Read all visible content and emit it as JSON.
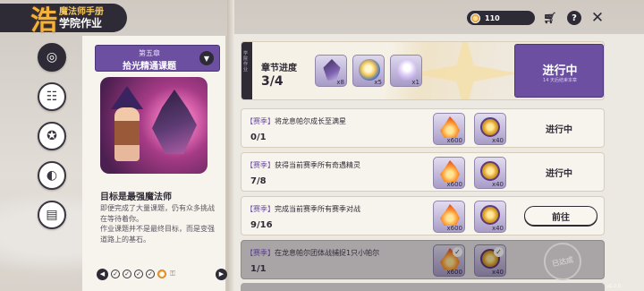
{
  "logo": {
    "mark": "浩",
    "line1": "魔法师手册",
    "line2": "学院作业"
  },
  "sidebar": {
    "items": [
      {
        "name": "sidebar-item-tasks",
        "icon": "◎",
        "active": true
      },
      {
        "name": "sidebar-item-book",
        "icon": "☷",
        "active": false
      },
      {
        "name": "sidebar-item-medal",
        "icon": "✪",
        "active": false
      },
      {
        "name": "sidebar-item-pet",
        "icon": "◐",
        "active": false
      },
      {
        "name": "sidebar-item-cards",
        "icon": "▤",
        "active": false
      }
    ]
  },
  "chapter": {
    "number": "第五章",
    "name": "拾光精通课题",
    "subtitle": "目标是最强魔法师",
    "desc": [
      "即便完成了大量课题，仍有众多挑战在等待着你。",
      "作业课题并不是最终目标，而是变强道路上的基石。"
    ]
  },
  "pager": {
    "prev": "◀",
    "next": "▶",
    "lock": "⚿"
  },
  "topbar": {
    "currency_value": "110"
  },
  "banner": {
    "vertical_text": "学院作业",
    "progress_label": "章节进度",
    "progress_value": "3/4",
    "rewards": [
      {
        "icon": "crystal-icon",
        "count": "x8"
      },
      {
        "icon": "orb-icon",
        "count": "x5"
      },
      {
        "icon": "spirit-icon",
        "count": "x1"
      }
    ],
    "status": "进行中",
    "status_sub": "14 天后结束本章"
  },
  "tasks": [
    {
      "tag": "【赛季】",
      "title": "将龙息帕尔成长至满星",
      "count": "0/1",
      "r1": "x600",
      "r2": "x40",
      "state": "进行中",
      "button": "",
      "done": false
    },
    {
      "tag": "【赛季】",
      "title": "获得当前赛季所有奇遇精灵",
      "count": "7/8",
      "r1": "x600",
      "r2": "x40",
      "state": "进行中",
      "button": "",
      "done": false
    },
    {
      "tag": "【赛季】",
      "title": "完成当前赛季所有赛季对战",
      "count": "9/16",
      "r1": "x600",
      "r2": "x40",
      "state": "",
      "button": "前往",
      "done": false
    },
    {
      "tag": "【赛季】",
      "title": "在龙息帕尔团体战捕捉1只小帕尔",
      "count": "1/1",
      "r1": "x600",
      "r2": "x40",
      "state": "",
      "button": "",
      "done": true,
      "stamp": "已达成"
    }
  ],
  "version": "v1.2.0"
}
